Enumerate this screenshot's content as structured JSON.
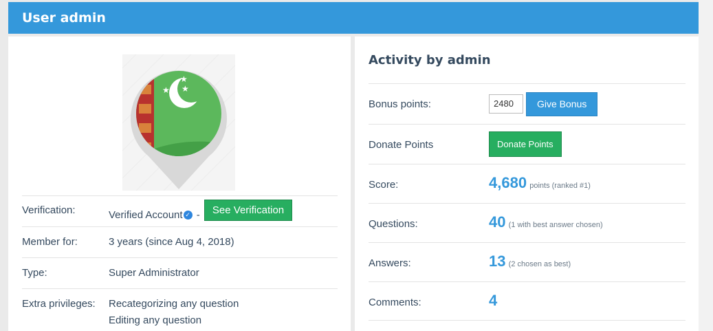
{
  "header": {
    "title": "User admin"
  },
  "profile": {
    "avatar_icon": "turkmenistan-flag-map-pin-icon",
    "rows": {
      "verification": {
        "label": "Verification:",
        "value": "Verified Account",
        "sep": "-",
        "button": "See Verification"
      },
      "member_for": {
        "label": "Member for:",
        "value": "3 years (since Aug 4, 2018)"
      },
      "type": {
        "label": "Type:",
        "value": "Super Administrator"
      },
      "extra": {
        "label": "Extra privileges:",
        "values": [
          "Recategorizing any question",
          "Editing any question"
        ]
      }
    }
  },
  "activity": {
    "title": "Activity by admin",
    "bonus": {
      "label": "Bonus points:",
      "value": "2480",
      "button": "Give Bonus"
    },
    "donate": {
      "label": "Donate Points",
      "button": "Donate Points"
    },
    "score": {
      "label": "Score:",
      "value": "4,680",
      "note": "points (ranked #1)"
    },
    "questions": {
      "label": "Questions:",
      "value": "40",
      "note": "(1 with best answer chosen)"
    },
    "answers": {
      "label": "Answers:",
      "value": "13",
      "note": "(2 chosen as best)"
    },
    "comments": {
      "label": "Comments:",
      "value": "4"
    }
  },
  "colors": {
    "header": "#3498db",
    "green": "#27ae60",
    "accent": "#3498db"
  }
}
